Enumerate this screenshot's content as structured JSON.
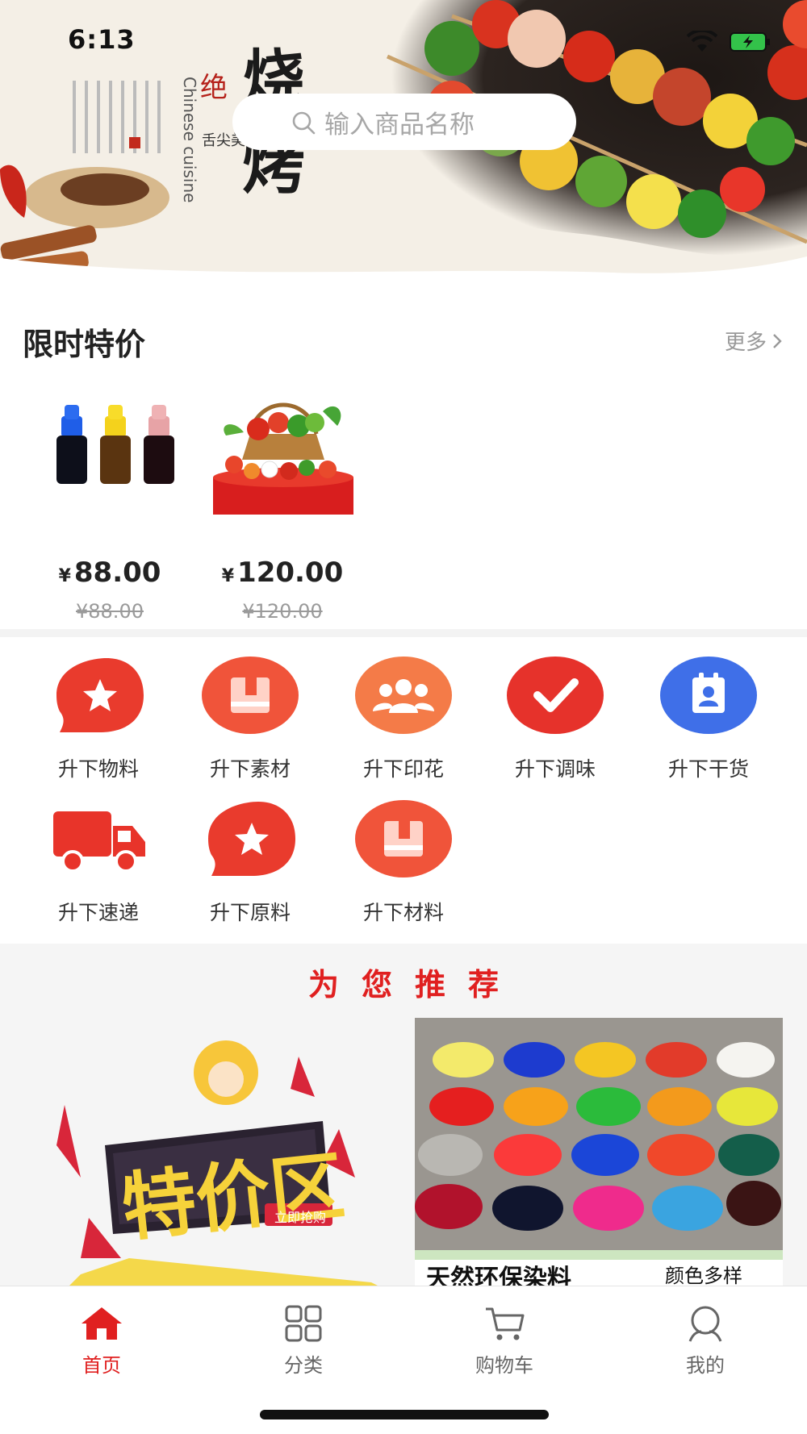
{
  "status_bar": {
    "time": "6:13"
  },
  "search": {
    "placeholder": "输入商品名称"
  },
  "banner": {
    "title_glyphs": "烧烤",
    "subtitle": "Chinese cuisine",
    "tagline": "舌尖美味"
  },
  "deals": {
    "title": "限时特价",
    "more_label": "更多",
    "products": [
      {
        "price": "88.00",
        "original_price": "¥88.00",
        "currency": "¥"
      },
      {
        "price": "120.00",
        "original_price": "¥120.00",
        "currency": "¥"
      }
    ]
  },
  "categories": [
    {
      "label": "升下物料",
      "icon": "star-icon",
      "color": "#e93b2d"
    },
    {
      "label": "升下素材",
      "icon": "book-icon",
      "color": "#f0543a"
    },
    {
      "label": "升下印花",
      "icon": "people-icon",
      "color": "#f47b48"
    },
    {
      "label": "升下调味",
      "icon": "check-icon",
      "color": "#e6322b"
    },
    {
      "label": "升下干货",
      "icon": "id-card-icon",
      "color": "#3f6fe8"
    },
    {
      "label": "升下速递",
      "icon": "truck-icon",
      "color": "#e8342a"
    },
    {
      "label": "升下原料",
      "icon": "star-icon",
      "color": "#e93b2d"
    },
    {
      "label": "升下材料",
      "icon": "book-icon",
      "color": "#f0543a"
    }
  ],
  "recommend": {
    "title": "为您推荐",
    "promo": {
      "headline": "特价区",
      "button": "立即抢购"
    },
    "powder": {
      "caption": "天然环保染料",
      "caption_right": "颜色多样"
    }
  },
  "tabbar": {
    "tabs": [
      {
        "label": "首页",
        "icon": "home-icon",
        "active": true
      },
      {
        "label": "分类",
        "icon": "grid-icon",
        "active": false
      },
      {
        "label": "购物车",
        "icon": "cart-icon",
        "active": false
      },
      {
        "label": "我的",
        "icon": "profile-icon",
        "active": false
      }
    ]
  },
  "colors": {
    "accent": "#e02020",
    "muted": "#999999"
  }
}
